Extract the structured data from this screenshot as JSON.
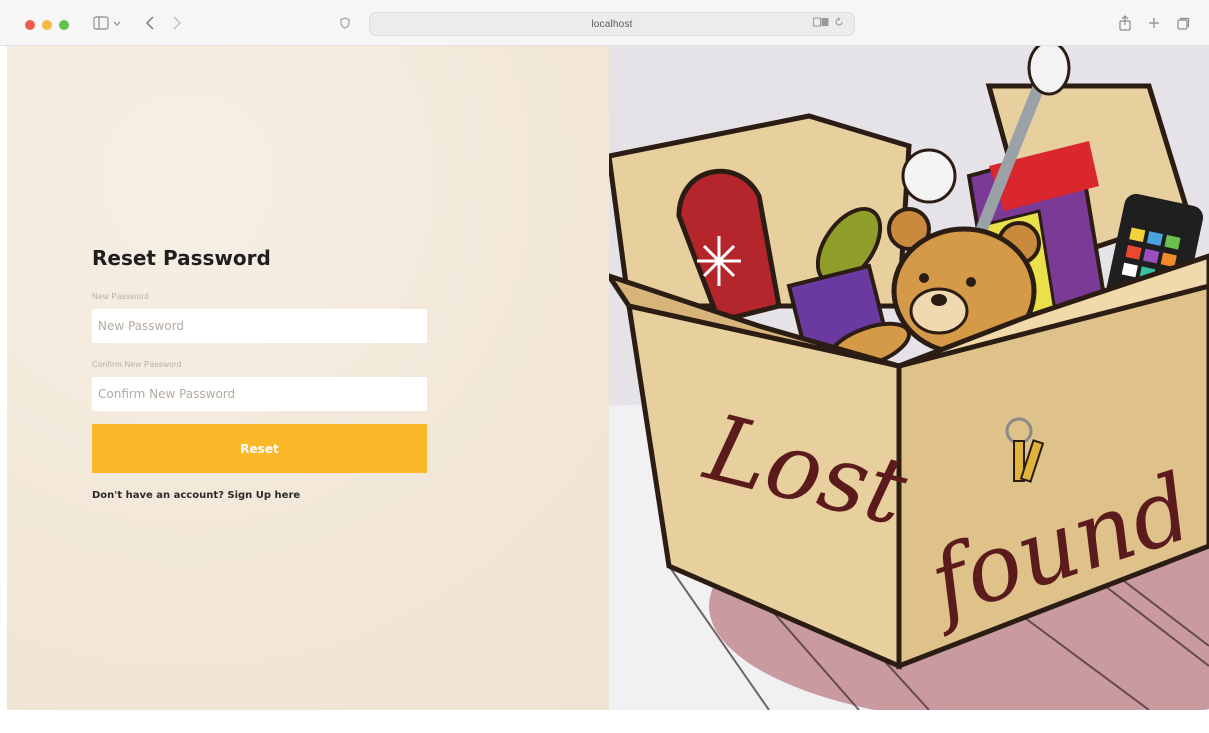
{
  "browser": {
    "url": "localhost",
    "icons": {
      "sidebar": "sidebar-icon",
      "back": "chevron-left-icon",
      "forward": "chevron-right-icon",
      "privacy": "shield-icon",
      "translate": "translate-icon",
      "reload": "reload-icon",
      "share": "share-icon",
      "new_tab": "plus-icon",
      "tabs": "tabs-overview-icon"
    }
  },
  "form": {
    "title": "Reset Password",
    "new_password_label": "New Password",
    "new_password_placeholder": "New Password",
    "confirm_password_label": "Confirm New Password",
    "confirm_password_placeholder": "Confirm New Password",
    "reset_label": "Reset",
    "signup_prompt": "Don't have an account? ",
    "signup_link": "Sign Up here"
  },
  "illustration": {
    "box_text_left": "Lost",
    "box_text_right": "found"
  },
  "colors": {
    "accent": "#fbb829",
    "left_background": "#f3e9dc",
    "box": "#e8cf9e",
    "box_outline": "#2b1d14",
    "box_lettering": "#5b1a1c"
  }
}
